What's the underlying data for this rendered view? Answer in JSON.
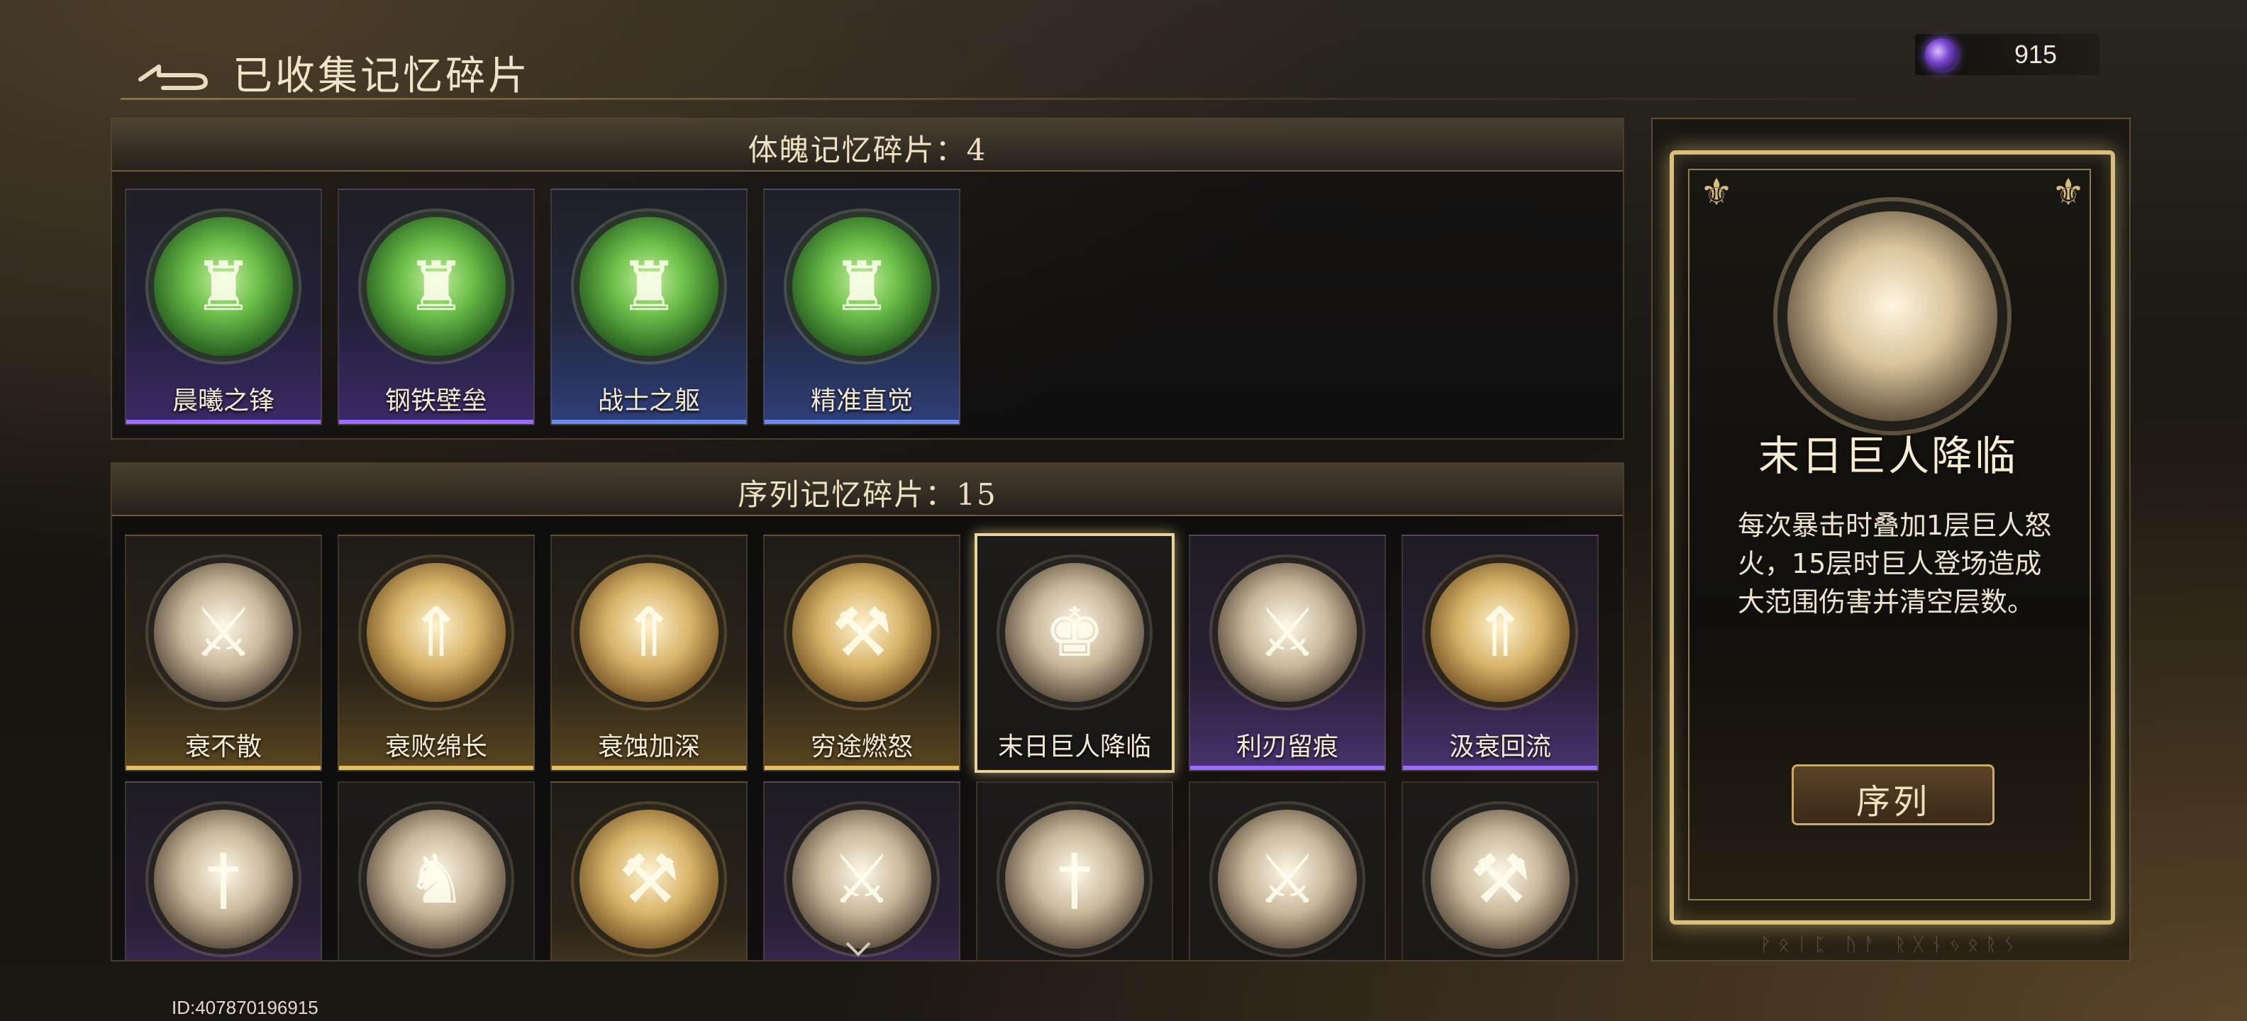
{
  "header": {
    "title": "已收集记忆碎片",
    "currency_value": "915",
    "currency_icon": "purple-crystal-icon",
    "back_icon": "back-arrow-icon"
  },
  "top_section": {
    "title": "体魄记忆碎片：4",
    "cards": [
      {
        "label": "晨曦之锋",
        "icon": "green-warrior-medal-icon",
        "rarity": "purple"
      },
      {
        "label": "钢铁壁垒",
        "icon": "green-warrior-medal-icon",
        "rarity": "purple"
      },
      {
        "label": "战士之躯",
        "icon": "green-warrior-medal-icon",
        "rarity": "blue"
      },
      {
        "label": "精准直觉",
        "icon": "green-warrior-medal-icon",
        "rarity": "blue"
      }
    ]
  },
  "bottom_section": {
    "title": "序列记忆碎片：15",
    "cards_row1": [
      {
        "label": "衰不散",
        "icon": "sword-medal-icon",
        "rarity": "gold"
      },
      {
        "label": "衰败绵长",
        "icon": "giant-upgrade-medal-icon",
        "rarity": "gold"
      },
      {
        "label": "衰蚀加深",
        "icon": "giant-upgrade-medal-icon",
        "rarity": "gold"
      },
      {
        "label": "穷途燃怒",
        "icon": "broken-sword-medal-icon",
        "rarity": "gold"
      },
      {
        "label": "末日巨人降临",
        "icon": "doom-giant-medal-icon",
        "rarity": "selected"
      },
      {
        "label": "利刃留痕",
        "icon": "blades-medal-icon",
        "rarity": "purple"
      },
      {
        "label": "汲衰回流",
        "icon": "giant-upgrade-medal-icon",
        "rarity": "purple"
      }
    ],
    "cards_row2": [
      {
        "icon": "sword-crest-medal-icon",
        "rarity": "purple"
      },
      {
        "icon": "warrior-medal-icon",
        "rarity": "dark"
      },
      {
        "icon": "broken-sword-medal-icon",
        "rarity": "gold"
      },
      {
        "icon": "blades-medal-icon",
        "rarity": "purple"
      },
      {
        "icon": "sword-crest-medal-icon",
        "rarity": "dark"
      },
      {
        "icon": "blades-medal-icon",
        "rarity": "dark"
      },
      {
        "icon": "broken-sword-medal-icon",
        "rarity": "dark"
      }
    ]
  },
  "detail": {
    "name": "末日巨人降临",
    "description": "每次暴击时叠加1层巨人怒火，15层时巨人登场造成大范围伤害并清空层数。",
    "category": "序列",
    "footer_text": "ᚹᛟᛁᛈ ᚢᚨ ᚱᚷᚾᛃᛟᚱᛊ"
  },
  "footer": {
    "player_id": "ID:407870196915"
  },
  "colors": {
    "gold_accent": "#d8bf7c",
    "purple_stripe": "#9a6cff",
    "blue_stripe": "#6a8cf0",
    "gold_stripe": "#e6c060"
  }
}
